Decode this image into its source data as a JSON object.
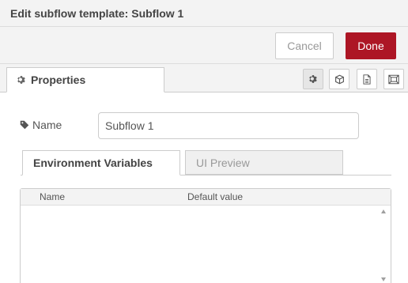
{
  "header": {
    "title": "Edit subflow template: Subflow 1"
  },
  "toolbar": {
    "cancel_label": "Cancel",
    "done_label": "Done"
  },
  "tabs": {
    "properties_label": "Properties",
    "icons": [
      "gear-icon",
      "cube-icon",
      "document-icon",
      "layout-icon"
    ],
    "active_icon": "gear-icon"
  },
  "form": {
    "name_label": "Name",
    "name_value": "Subflow 1"
  },
  "inner_tabs": [
    {
      "label": "Environment Variables",
      "active": true
    },
    {
      "label": "UI Preview",
      "active": false
    }
  ],
  "env_table": {
    "columns": [
      "Name",
      "Default value"
    ]
  },
  "colors": {
    "primary_button": "#ad1625",
    "header_bg": "#f3f3f3",
    "border": "#cccccc"
  }
}
